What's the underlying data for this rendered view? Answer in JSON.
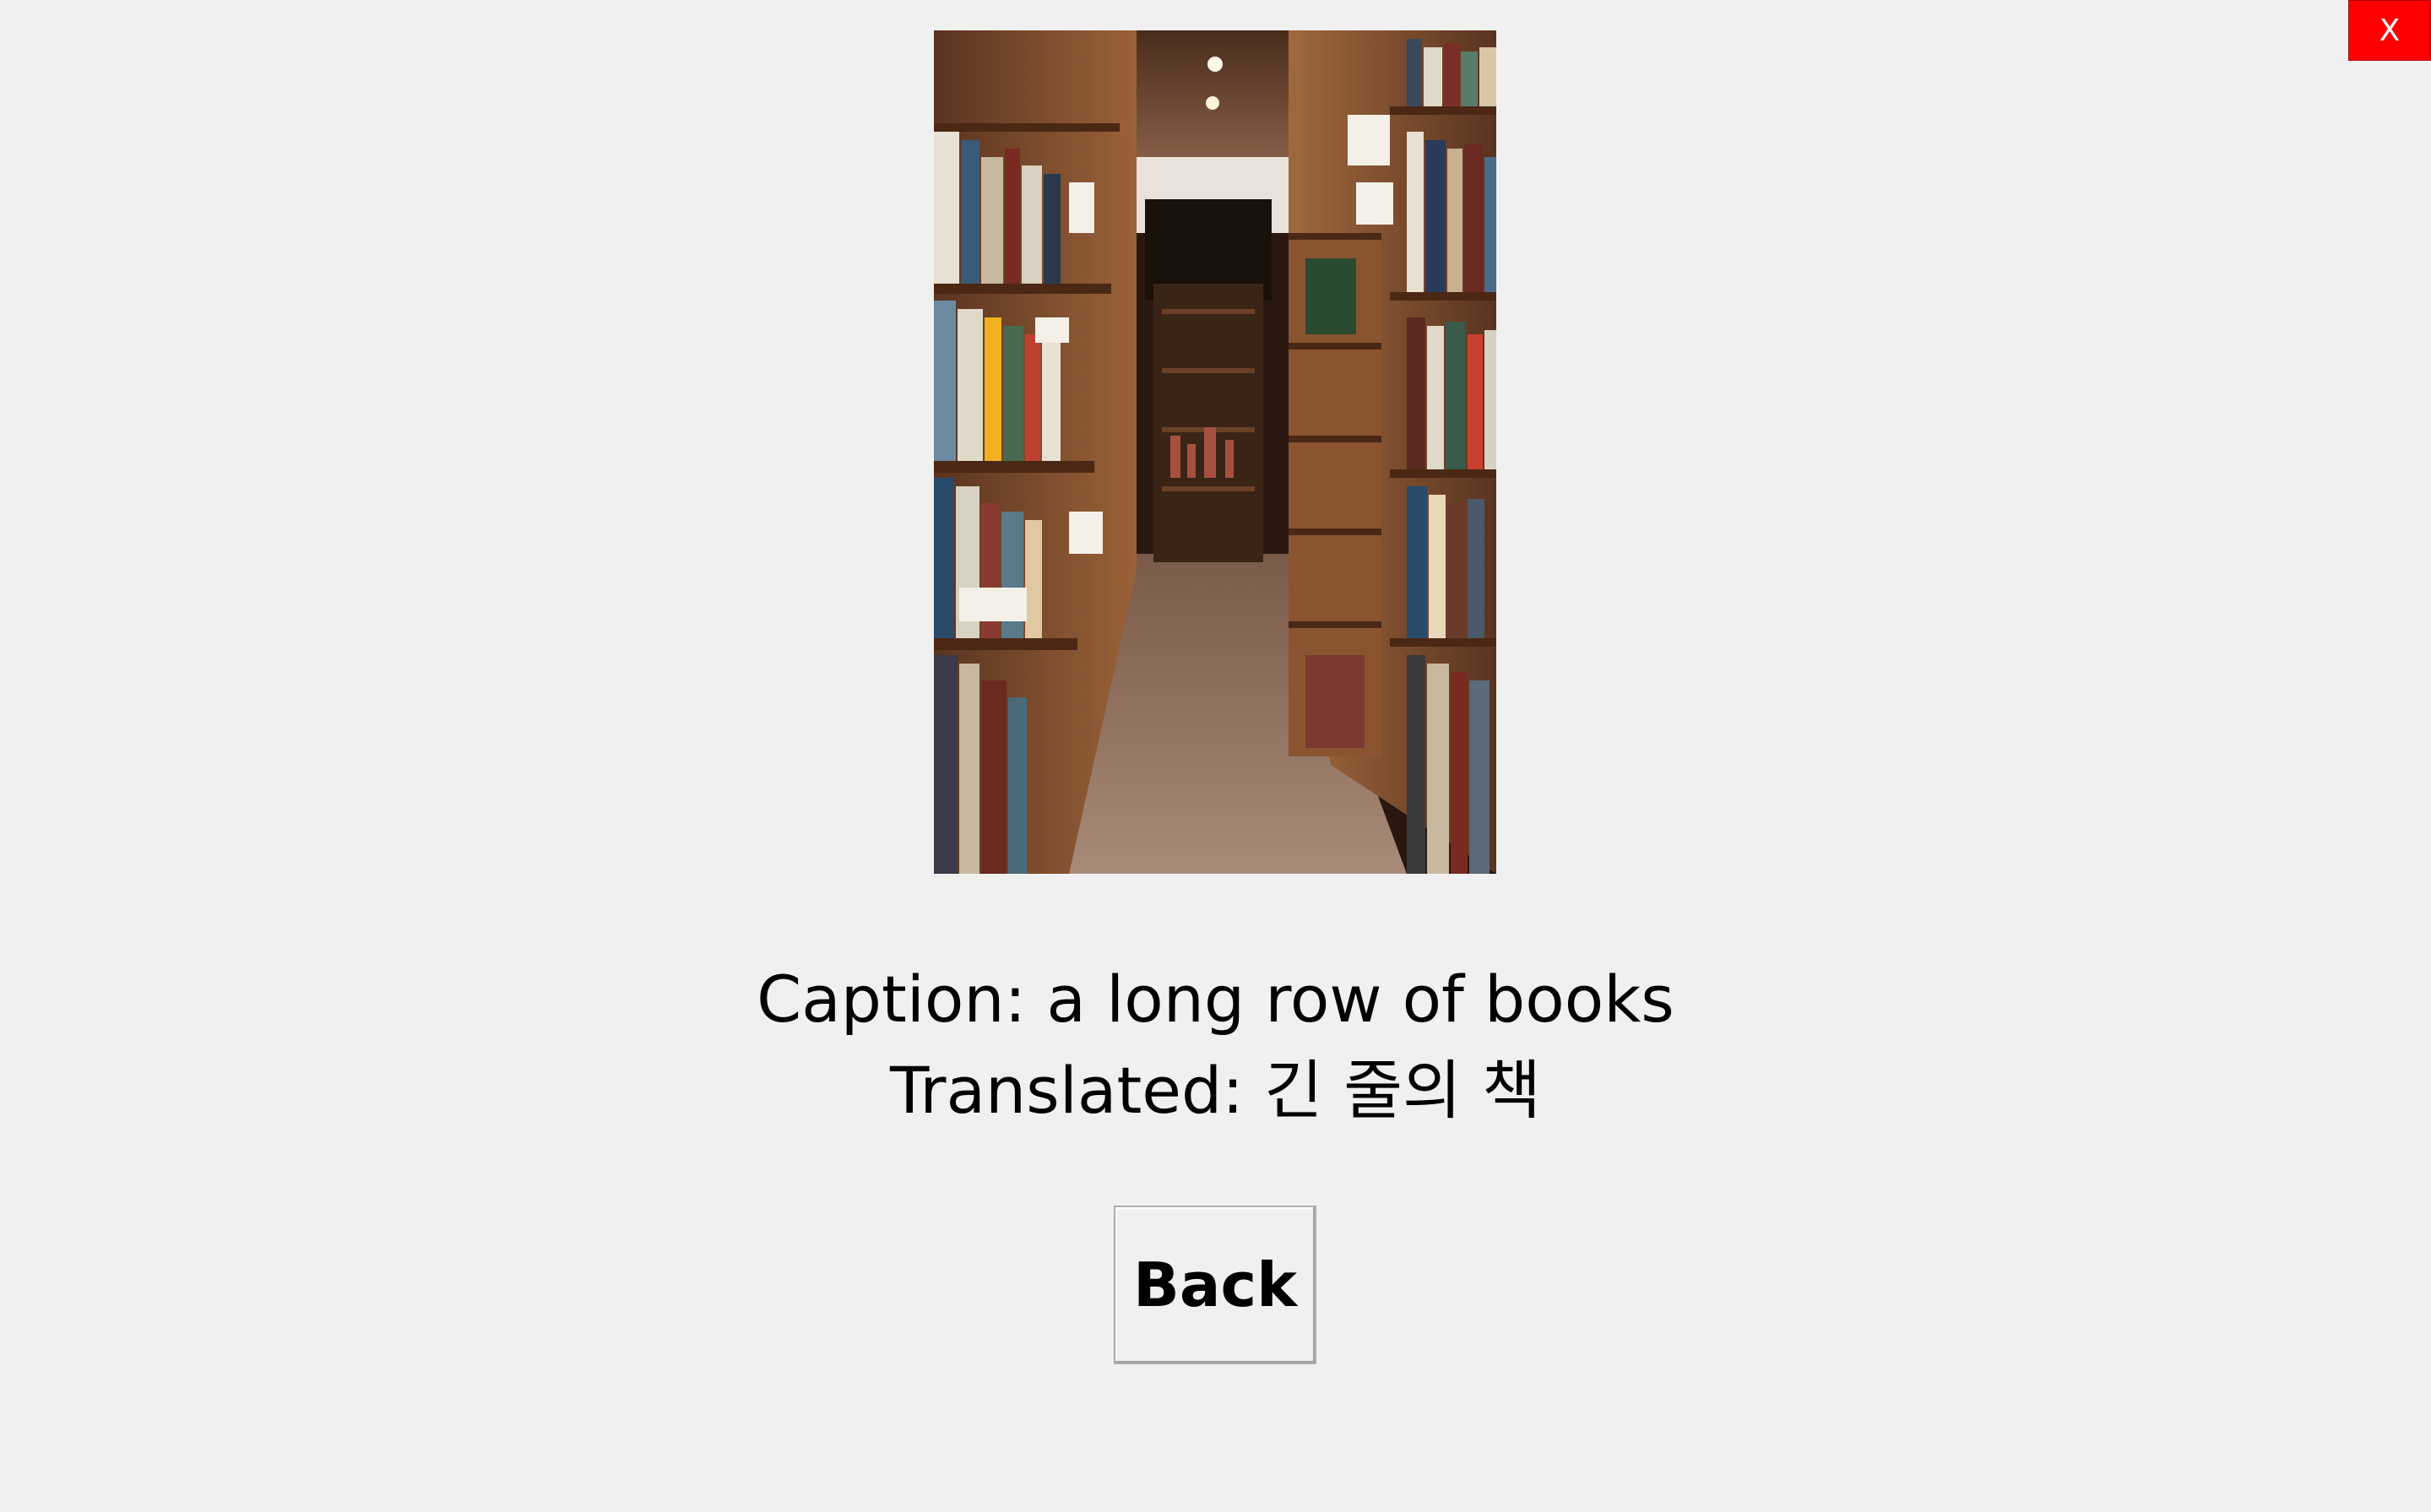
{
  "window": {
    "close_label": "X"
  },
  "image": {
    "alt": "Library aisle with tall wooden bookshelves"
  },
  "result": {
    "caption_prefix": "Caption:",
    "caption_text": "a long row of books",
    "translated_prefix": "Translated:",
    "translated_text": "긴 줄의 책"
  },
  "actions": {
    "back_label": "Back"
  },
  "colors": {
    "background": "#f0f0f0",
    "close_button": "#ff0000"
  }
}
